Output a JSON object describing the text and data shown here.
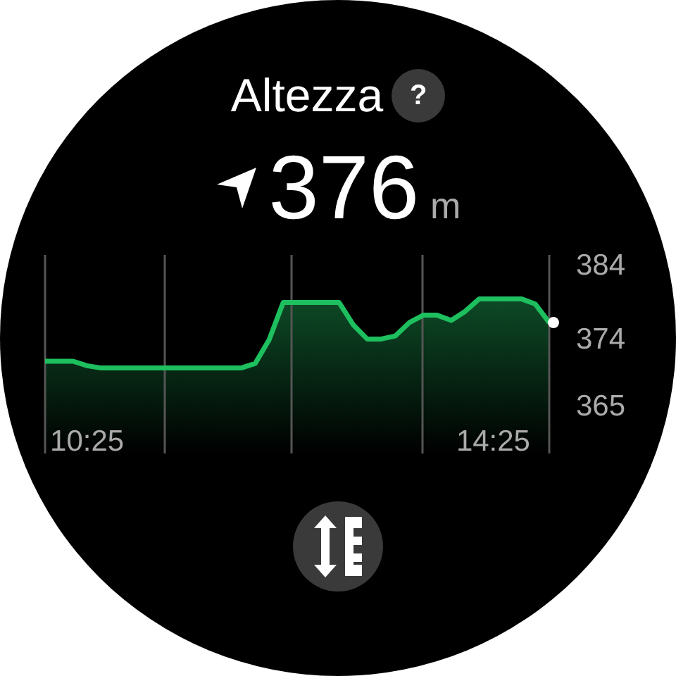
{
  "title": "Altezza",
  "help_label": "?",
  "reading": {
    "value": "376",
    "unit": "m"
  },
  "chart_data": {
    "type": "area",
    "ylim": [
      358.4,
      385.1
    ],
    "yticks": [
      384,
      374,
      365
    ],
    "categories": [
      null,
      null,
      null,
      "10:25",
      null,
      null,
      null,
      null,
      null,
      null,
      null,
      null,
      null,
      null,
      null,
      null,
      null,
      null,
      null,
      null,
      null,
      null,
      null,
      null,
      null,
      null,
      null,
      null,
      null,
      null,
      null,
      null,
      "14:25",
      null,
      null,
      null,
      null
    ],
    "series": [
      {
        "color": "#1dbf5e",
        "values": [
          370.8,
          370.8,
          370.8,
          370.2,
          369.9,
          369.9,
          369.9,
          369.9,
          369.9,
          369.9,
          369.9,
          369.9,
          369.9,
          369.9,
          369.9,
          370.5,
          373.7,
          378.7,
          378.7,
          378.7,
          378.7,
          378.7,
          375.7,
          373.8,
          373.8,
          374.2,
          376.0,
          377,
          377,
          376.3,
          377.5,
          379.2,
          379.2,
          379.2,
          379.2,
          378.5,
          376
        ]
      }
    ]
  }
}
